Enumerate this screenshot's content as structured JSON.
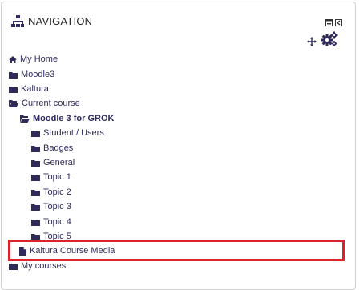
{
  "block": {
    "title": "NAVIGATION",
    "icons": [
      "sitemap-icon",
      "dock-icon",
      "hide-block-icon",
      "move-icon",
      "gears-icon"
    ]
  },
  "nav": {
    "my_home": "My Home",
    "moodle3": "Moodle3",
    "kaltura": "Kaltura",
    "current_course": "Current course",
    "course_name": "Moodle 3 for GROK",
    "sections": [
      "Student / Users",
      "Badges",
      "General",
      "Topic 1",
      "Topic 2",
      "Topic 3",
      "Topic 4",
      "Topic 5"
    ],
    "kaltura_media": "Kaltura Course Media",
    "my_courses": "My courses"
  },
  "colors": {
    "text": "#2e2a5a",
    "highlight_border": "#e0202a",
    "block_border": "#d0d0d0"
  }
}
